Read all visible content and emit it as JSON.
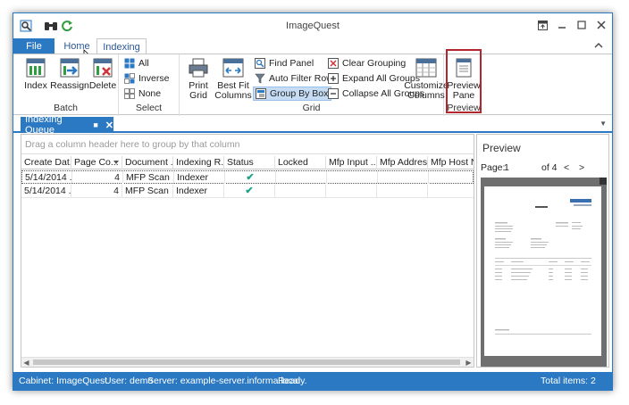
{
  "window": {
    "title": "ImageQuest"
  },
  "tabs": {
    "file": "File",
    "home": "Home",
    "indexing": "Indexing"
  },
  "ribbon": {
    "batch": {
      "label": "Batch",
      "index": "Index",
      "reassign": "Reassign",
      "delete": "Delete"
    },
    "select": {
      "label": "Select",
      "all": "All",
      "inverse": "Inverse",
      "none": "None"
    },
    "grid": {
      "label": "Grid",
      "print_line1": "Print",
      "print_line2": "Grid",
      "bestfit_line1": "Best Fit",
      "bestfit_line2": "Columns",
      "find_panel": "Find Panel",
      "auto_filter_row": "Auto Filter Row",
      "group_by_box": "Group By Box",
      "clear_grouping": "Clear Grouping",
      "expand_all_groups": "Expand All Groups",
      "collapse_all_groups": "Collapse All Groups",
      "customize_line1": "Customize",
      "customize_line2": "Columns"
    },
    "preview": {
      "label": "Preview",
      "pane_line1": "Preview",
      "pane_line2": "Pane"
    }
  },
  "doc_tab": {
    "label": "Indexing Queue"
  },
  "grid": {
    "group_panel_text": "Drag a column header here to group by that column",
    "columns": [
      "Create Dat...",
      "Page Co...",
      "Document ...",
      "Indexing R...",
      "Status",
      "Locked",
      "Mfp Input ...",
      "Mfp Address",
      "Mfp Host N..."
    ],
    "rows": [
      [
        "5/14/2014 ...",
        "4",
        "MFP Scan",
        "Indexer",
        "",
        "",
        "",
        "",
        ""
      ],
      [
        "5/14/2014 ...",
        "4",
        "MFP Scan",
        "Indexer",
        "",
        "",
        "",
        "",
        ""
      ]
    ]
  },
  "preview_pane": {
    "title": "Preview",
    "page_label": "Page:",
    "page_value": "1",
    "of_label": "of 4",
    "prev": "<",
    "next": ">"
  },
  "status_bar": {
    "cabinet": "Cabinet: ImageQuest",
    "user": "User: demo",
    "server": "Server: example-server.informa.local",
    "state": "Ready.",
    "total": "Total items: 2"
  },
  "colors": {
    "accent": "#2b79c2",
    "highlight": "#b3262d",
    "check": "#1aa28b"
  }
}
